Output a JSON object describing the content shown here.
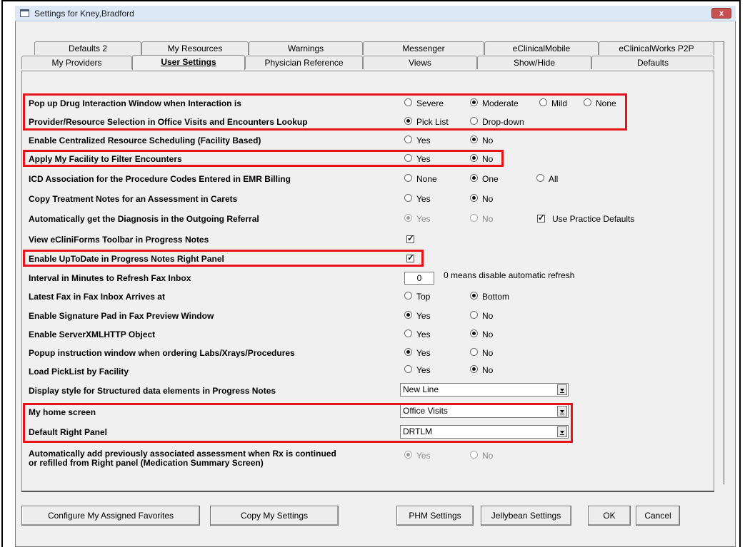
{
  "window": {
    "title": "Settings for Kney,Bradford",
    "close_label": "x"
  },
  "tabs_row1": [
    "Defaults 2",
    "My Resources",
    "Warnings",
    "Messenger",
    "eClinicalMobile",
    "eClinicalWorks P2P"
  ],
  "tabs_row2": [
    "My Providers",
    "User Settings",
    "Physician Reference",
    "Views",
    "Show/Hide",
    "Defaults"
  ],
  "active_tab": "User Settings",
  "settings": {
    "drug_interaction": {
      "label": "Pop up Drug Interaction Window when Interaction is",
      "options": [
        "Severe",
        "Moderate",
        "Mild",
        "None"
      ],
      "selected": "Moderate"
    },
    "provider_selection": {
      "label": "Provider/Resource Selection in Office Visits and Encounters Lookup",
      "options": [
        "Pick List",
        "Drop-down"
      ],
      "selected": "Pick List"
    },
    "centralized_scheduling": {
      "label": "Enable Centralized Resource Scheduling (Facility Based)",
      "options": [
        "Yes",
        "No"
      ],
      "selected": "No"
    },
    "facility_filter": {
      "label": "Apply My Facility to Filter Encounters",
      "options": [
        "Yes",
        "No"
      ],
      "selected": "No"
    },
    "icd_association": {
      "label": "ICD Association for the Procedure Codes Entered in EMR Billing",
      "options": [
        "None",
        "One",
        "All"
      ],
      "selected": "One"
    },
    "copy_treatment": {
      "label": "Copy Treatment Notes for an Assessment in Carets",
      "options": [
        "Yes",
        "No"
      ],
      "selected": "No"
    },
    "auto_diagnosis": {
      "label": "Automatically get the Diagnosis in the Outgoing Referral",
      "options": [
        "Yes",
        "No"
      ],
      "selected": "Yes",
      "disabled": true,
      "practice_defaults_label": "Use Practice Defaults",
      "practice_defaults_checked": true
    },
    "ecliniforms_toolbar": {
      "label": "View eCliniForms Toolbar in Progress Notes",
      "checked": true
    },
    "uptodate": {
      "label": "Enable UpToDate in Progress Notes Right Panel",
      "checked": true
    },
    "fax_refresh": {
      "label": "Interval in Minutes to Refresh Fax Inbox",
      "value": "0",
      "hint": "0 means disable automatic refresh"
    },
    "fax_arrival": {
      "label": "Latest Fax in Fax Inbox Arrives at",
      "options": [
        "Top",
        "Bottom"
      ],
      "selected": "Bottom"
    },
    "signature_pad": {
      "label": "Enable Signature Pad in Fax Preview Window",
      "options": [
        "Yes",
        "No"
      ],
      "selected": "Yes"
    },
    "serverxmlhttp": {
      "label": "Enable ServerXMLHTTP Object",
      "options": [
        "Yes",
        "No"
      ],
      "selected": "No"
    },
    "popup_instruction": {
      "label": "Popup instruction window when ordering Labs/Xrays/Procedures",
      "options": [
        "Yes",
        "No"
      ],
      "selected": "Yes"
    },
    "picklist_facility": {
      "label": "Load PickList by Facility",
      "options": [
        "Yes",
        "No"
      ],
      "selected": "No"
    },
    "display_style": {
      "label": "Display style for Structured data elements in Progress Notes",
      "value": "New Line"
    },
    "home_screen": {
      "label": "My home screen",
      "value": "Office Visits"
    },
    "right_panel": {
      "label": "Default Right Panel",
      "value": "DRTLM"
    },
    "auto_add_assessment": {
      "label_line1": "Automatically add previously associated assessment when Rx is continued",
      "label_line2": "or refilled from Right panel (Medication Summary Screen)",
      "options": [
        "Yes",
        "No"
      ],
      "selected": "Yes",
      "disabled": true
    }
  },
  "buttons": {
    "configure_favorites": "Configure My Assigned Favorites",
    "copy_settings": "Copy My Settings",
    "phm_settings": "PHM Settings",
    "jellybean_settings": "Jellybean Settings",
    "ok": "OK",
    "cancel": "Cancel"
  },
  "colors": {
    "highlight": "#e8121b",
    "dialog_bg": "#f0f0f0",
    "titlebar": "#dde8f6"
  }
}
